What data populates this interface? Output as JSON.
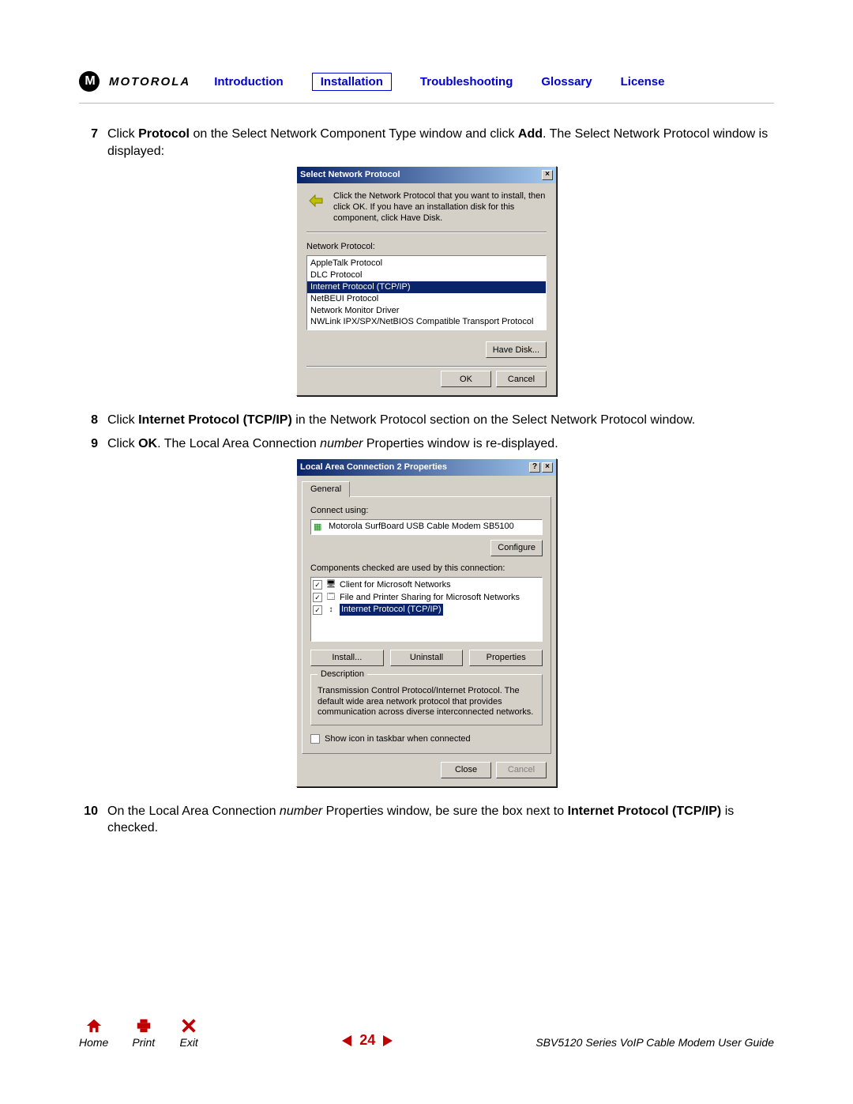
{
  "header": {
    "brand": "MOTOROLA",
    "nav": {
      "introduction": "Introduction",
      "installation": "Installation",
      "troubleshooting": "Troubleshooting",
      "glossary": "Glossary",
      "license": "License"
    }
  },
  "steps": {
    "s7": {
      "num": "7",
      "t1": "Click ",
      "b1": "Protocol",
      "t2": " on the Select Network Component Type window and click ",
      "b2": "Add",
      "t3": ". The Select Network Protocol window is displayed:"
    },
    "s8": {
      "num": "8",
      "t1": "Click ",
      "b1": "Internet Protocol (TCP/IP)",
      "t2": " in the Network Protocol section on the Select Network Protocol window."
    },
    "s9": {
      "num": "9",
      "t1": "Click ",
      "b1": "OK",
      "t2": ". The Local Area Connection ",
      "i1": "number",
      "t3": " Properties window is re-displayed."
    },
    "s10": {
      "num": "10",
      "t1": "On the Local Area Connection ",
      "i1": "number",
      "t2": " Properties window, be sure the box next to ",
      "b1": "Internet Protocol (TCP/IP)",
      "t3": " is checked."
    }
  },
  "dlg1": {
    "title": "Select Network Protocol",
    "desc": "Click the Network Protocol that you want to install, then click OK. If you have an installation disk for this component, click Have Disk.",
    "listLabel": "Network Protocol:",
    "items": [
      "AppleTalk Protocol",
      "DLC Protocol",
      "Internet Protocol (TCP/IP)",
      "NetBEUI Protocol",
      "Network Monitor Driver",
      "NWLink IPX/SPX/NetBIOS Compatible Transport Protocol"
    ],
    "haveDisk": "Have Disk...",
    "ok": "OK",
    "cancel": "Cancel"
  },
  "dlg2": {
    "title": "Local Area Connection 2 Properties",
    "tab": "General",
    "connectLabel": "Connect using:",
    "device": "Motorola SurfBoard USB Cable Modem SB5100",
    "configure": "Configure",
    "compsLabel": "Components checked are used by this connection:",
    "comps": [
      "Client for Microsoft Networks",
      "File and Printer Sharing for Microsoft Networks",
      "Internet Protocol (TCP/IP)"
    ],
    "install": "Install...",
    "uninstall": "Uninstall",
    "properties": "Properties",
    "descLegend": "Description",
    "descText": "Transmission Control Protocol/Internet Protocol. The default wide area network protocol that provides communication across diverse interconnected networks.",
    "showIcon": "Show icon in taskbar when connected",
    "close": "Close",
    "cancel": "Cancel"
  },
  "footer": {
    "home": "Home",
    "print": "Print",
    "exit": "Exit",
    "page": "24",
    "guide": "SBV5120 Series VoIP Cable Modem User Guide"
  }
}
